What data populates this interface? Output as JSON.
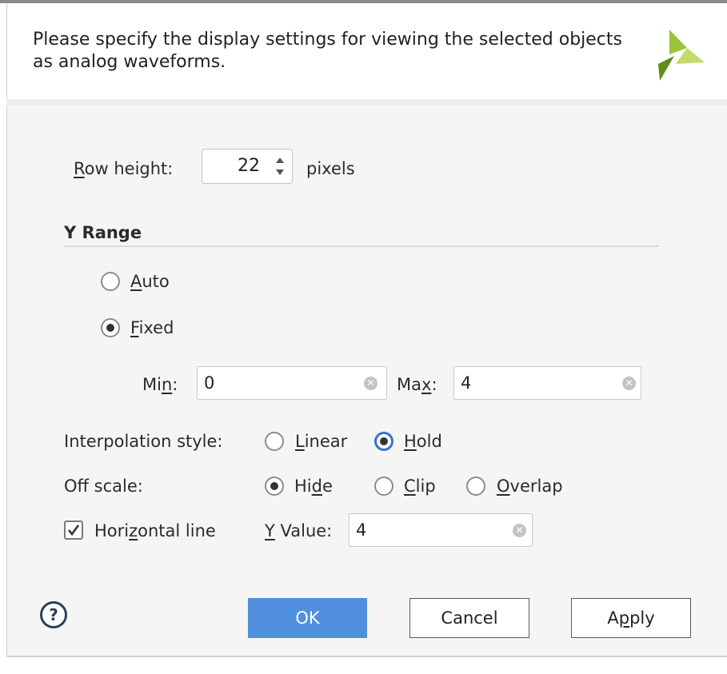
{
  "dialog": {
    "message": "Please specify the display settings for viewing the selected objects as analog waveforms.",
    "logo_icon": "xilinx-logo-icon"
  },
  "row_height": {
    "label_first": "R",
    "label_rest": "ow height:",
    "value": "22",
    "unit": "pixels"
  },
  "y_range": {
    "title": "Y Range",
    "auto": {
      "first": "A",
      "rest": "uto",
      "checked": false
    },
    "fixed": {
      "first": "F",
      "rest": "ixed",
      "checked": true
    },
    "min": {
      "label_a": "Mi",
      "label_u": "n",
      "label_b": ":",
      "value": "0"
    },
    "max": {
      "label_a": "Ma",
      "label_u": "x",
      "label_b": ":",
      "value": "4"
    }
  },
  "interpolation": {
    "label": "Interpolation style:",
    "linear": {
      "first": "L",
      "rest": "inear",
      "checked": false
    },
    "hold": {
      "first": "H",
      "rest": "old",
      "checked": true
    }
  },
  "off_scale": {
    "label": "Off scale:",
    "hide": {
      "a": "Hi",
      "u": "d",
      "b": "e",
      "checked": true
    },
    "clip": {
      "first": "C",
      "rest": "lip",
      "checked": false
    },
    "overlap": {
      "first": "O",
      "rest": "verlap",
      "checked": false
    }
  },
  "horizontal_line": {
    "a": "Hori",
    "u": "z",
    "b": "ontal line",
    "checked": true,
    "y_value_first": "Y",
    "y_value_rest": " Value:",
    "y_value": "4"
  },
  "buttons": {
    "help": "?",
    "ok": "OK",
    "cancel": "Cancel",
    "apply_a": "A",
    "apply_u": "p",
    "apply_b": "ply"
  },
  "colors": {
    "accent": "#4f8fde",
    "focus": "#3b6fd1",
    "logo_green": "#7ab21f"
  }
}
